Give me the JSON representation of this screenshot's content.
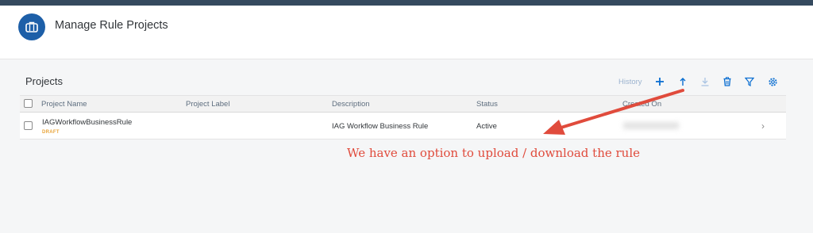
{
  "app": {
    "title": "Manage Rule Projects",
    "icon": "briefcase-icon",
    "accent": "#1d5fa8"
  },
  "panel": {
    "title": "Projects"
  },
  "toolbar": {
    "history_label": "History",
    "buttons": [
      "add-icon",
      "upload-icon",
      "download-icon",
      "delete-icon",
      "filter-icon",
      "settings-icon"
    ]
  },
  "table": {
    "columns": [
      "Project Name",
      "Project Label",
      "Description",
      "Status",
      "Created On"
    ],
    "rows": [
      {
        "name": "IAGWorkflowBusinessRule",
        "badge": "DRAFT",
        "label": "",
        "description": "IAG Workflow Business Rule",
        "status": "Active"
      }
    ]
  },
  "annotation": {
    "text": "We have an option to upload / download the rule",
    "color": "#e04b3c"
  }
}
